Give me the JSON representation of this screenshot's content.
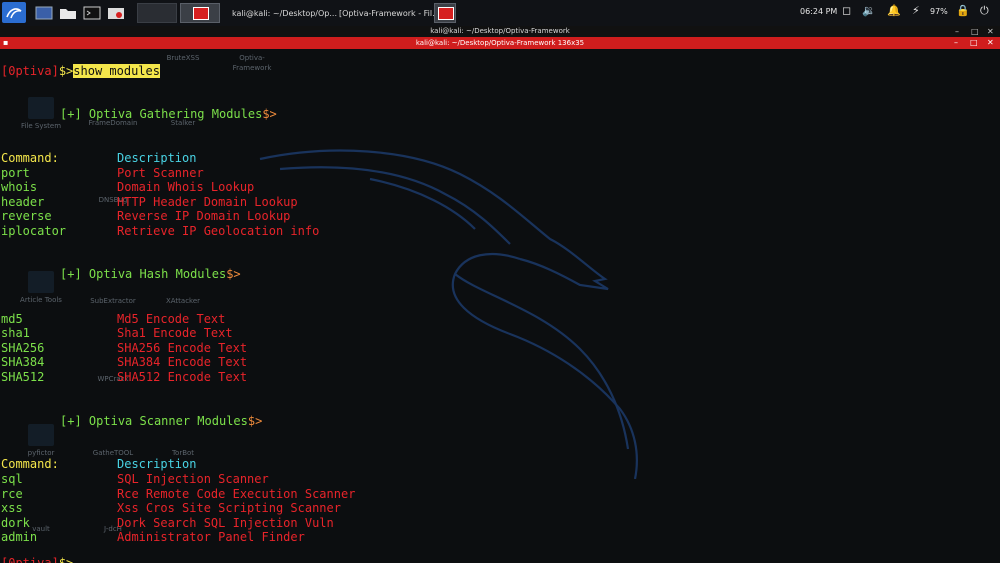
{
  "panel": {
    "clock": "06:24 PM",
    "battery_percent": "97%",
    "tasks": [
      {
        "label": "kali@kali: ~/Desktop/Op..."
      },
      {
        "label": "[Optiva-Framework - Fil..."
      }
    ]
  },
  "window": {
    "title_small": "kali@kali: ~/Desktop/Optiva-Framework",
    "title_bar": "kali@kali: ~/Desktop/Optiva-Framework 136x35"
  },
  "desktop_icons": [
    {
      "label": "File System"
    },
    {
      "label": "FrameDomain"
    },
    {
      "label": "Stalker"
    },
    {
      "label": "BruteXSS"
    },
    {
      "label": "Optiva-"
    },
    {
      "label": "Framework"
    },
    {
      "label": "DNSBug"
    },
    {
      "label": "Article Tools"
    },
    {
      "label": "SubExtractor"
    },
    {
      "label": "XAttacker"
    },
    {
      "label": "pyfictor"
    },
    {
      "label": "GatheTOOL"
    },
    {
      "label": "TorBot"
    },
    {
      "label": "vault"
    },
    {
      "label": "J-dcH"
    },
    {
      "label": "WPCrack"
    }
  ],
  "terminal": {
    "prompt_open": "[",
    "prompt_name": "0ptiva",
    "prompt_close": "]",
    "prompt_symbol": "$>",
    "command": "show modules",
    "sections": [
      {
        "header_prefix": "[+]",
        "header": "Optiva Gathering Modules",
        "header_suffix": "$>",
        "col_left": "Command:",
        "col_right": "Description",
        "rows": [
          {
            "cmd": "port",
            "desc": "Port Scanner"
          },
          {
            "cmd": "whois",
            "desc": "Domain Whois Lookup"
          },
          {
            "cmd": "header",
            "desc": "HTTP Header Domain Lookup"
          },
          {
            "cmd": "reverse",
            "desc": "Reverse IP Domain Lookup"
          },
          {
            "cmd": "iplocator",
            "desc": "Retrieve IP Geolocation info"
          }
        ]
      },
      {
        "header_prefix": "[+]",
        "header": "Optiva Hash Modules",
        "header_suffix": "$>",
        "rows": [
          {
            "cmd": "md5",
            "desc": "Md5 Encode Text"
          },
          {
            "cmd": "sha1",
            "desc": "Sha1 Encode Text"
          },
          {
            "cmd": "SHA256",
            "desc": "SHA256 Encode Text"
          },
          {
            "cmd": "SHA384",
            "desc": "SHA384 Encode Text"
          },
          {
            "cmd": "SHA512",
            "desc": "SHA512 Encode Text"
          }
        ]
      },
      {
        "header_prefix": "[+]",
        "header": "Optiva Scanner Modules",
        "header_suffix": "$>",
        "col_left": "Command:",
        "col_right": "Description",
        "rows": [
          {
            "cmd": "sql",
            "desc": "SQL Injection Scanner"
          },
          {
            "cmd": "rce",
            "desc": "Rce Remote Code Execution Scanner"
          },
          {
            "cmd": "xss",
            "desc": "Xss Cros Site Scripting Scanner"
          },
          {
            "cmd": "dork",
            "desc": "Dork Search SQL Injection Vuln"
          },
          {
            "cmd": "admin",
            "desc": "Administrator Panel Finder"
          }
        ]
      }
    ]
  }
}
